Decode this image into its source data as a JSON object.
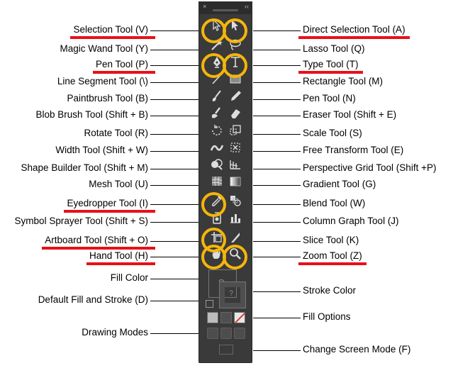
{
  "left_labels": [
    {
      "text": "Selection Tool (V)",
      "highlight": true
    },
    {
      "text": "Magic Wand Tool (Y)",
      "highlight": false
    },
    {
      "text": "Pen Tool (P)",
      "highlight": true
    },
    {
      "text": "Line Segment Tool (\\)",
      "highlight": false
    },
    {
      "text": "Paintbrush Tool (B)",
      "highlight": false
    },
    {
      "text": "Blob Brush Tool (Shift + B)",
      "highlight": false
    },
    {
      "text": "Rotate Tool (R)",
      "highlight": false
    },
    {
      "text": "Width Tool (Shift + W)",
      "highlight": false
    },
    {
      "text": "Shape Builder Tool (Shift + M)",
      "highlight": false
    },
    {
      "text": "Mesh Tool (U)",
      "highlight": false
    },
    {
      "text": "Eyedropper Tool (I)",
      "highlight": true
    },
    {
      "text": "Symbol Sprayer Tool (Shift + S)",
      "highlight": false
    },
    {
      "text": "Artboard Tool (Shift + O)",
      "highlight": true
    },
    {
      "text": "Hand Tool (H)",
      "highlight": true
    },
    {
      "text": "Fill Color",
      "highlight": false
    },
    {
      "text": "Default Fill and Stroke (D)",
      "highlight": false
    },
    {
      "text": "Drawing Modes",
      "highlight": false
    }
  ],
  "right_labels": [
    {
      "text": "Direct Selection Tool (A)",
      "highlight": true
    },
    {
      "text": "Lasso Tool (Q)",
      "highlight": false
    },
    {
      "text": "Type Tool (T)",
      "highlight": true
    },
    {
      "text": "Rectangle Tool (M)",
      "highlight": false
    },
    {
      "text": "Pen Tool (N)",
      "highlight": false
    },
    {
      "text": "Eraser Tool (Shift + E)",
      "highlight": false
    },
    {
      "text": "Scale Tool (S)",
      "highlight": false
    },
    {
      "text": "Free Transform Tool (E)",
      "highlight": false
    },
    {
      "text": "Perspective Grid Tool (Shift +P)",
      "highlight": false
    },
    {
      "text": "Gradient Tool (G)",
      "highlight": false
    },
    {
      "text": "Blend Tool (W)",
      "highlight": false
    },
    {
      "text": "Column Graph Tool (J)",
      "highlight": false
    },
    {
      "text": "Slice Tool (K)",
      "highlight": false
    },
    {
      "text": "Zoom Tool (Z)",
      "highlight": true
    },
    {
      "text": "Stroke Color",
      "highlight": false
    },
    {
      "text": "Fill Options",
      "highlight": false
    },
    {
      "text": "Change Screen Mode (F)",
      "highlight": false
    }
  ],
  "panel": {
    "close_glyph": "×",
    "collapse_glyph": "‹‹",
    "icons": [
      "selection-tool",
      "direct-selection-tool",
      "magic-wand-tool",
      "lasso-tool",
      "pen-tool",
      "type-tool",
      "line-segment-tool",
      "rectangle-tool",
      "paintbrush-tool",
      "pencil-tool",
      "blob-brush-tool",
      "eraser-tool",
      "rotate-tool",
      "scale-tool",
      "width-tool",
      "free-transform-tool",
      "shape-builder-tool",
      "perspective-grid-tool",
      "mesh-tool",
      "gradient-tool",
      "eyedropper-tool",
      "blend-tool",
      "symbol-sprayer-tool",
      "column-graph-tool",
      "artboard-tool",
      "slice-tool",
      "hand-tool",
      "zoom-tool"
    ],
    "fill_question": "?",
    "stroke_question": "?",
    "colors": {
      "panel": "#3a3a3a",
      "ring": "#f5b50a",
      "underline": "#e8101a",
      "none_swatch": "#d63a3a"
    }
  }
}
